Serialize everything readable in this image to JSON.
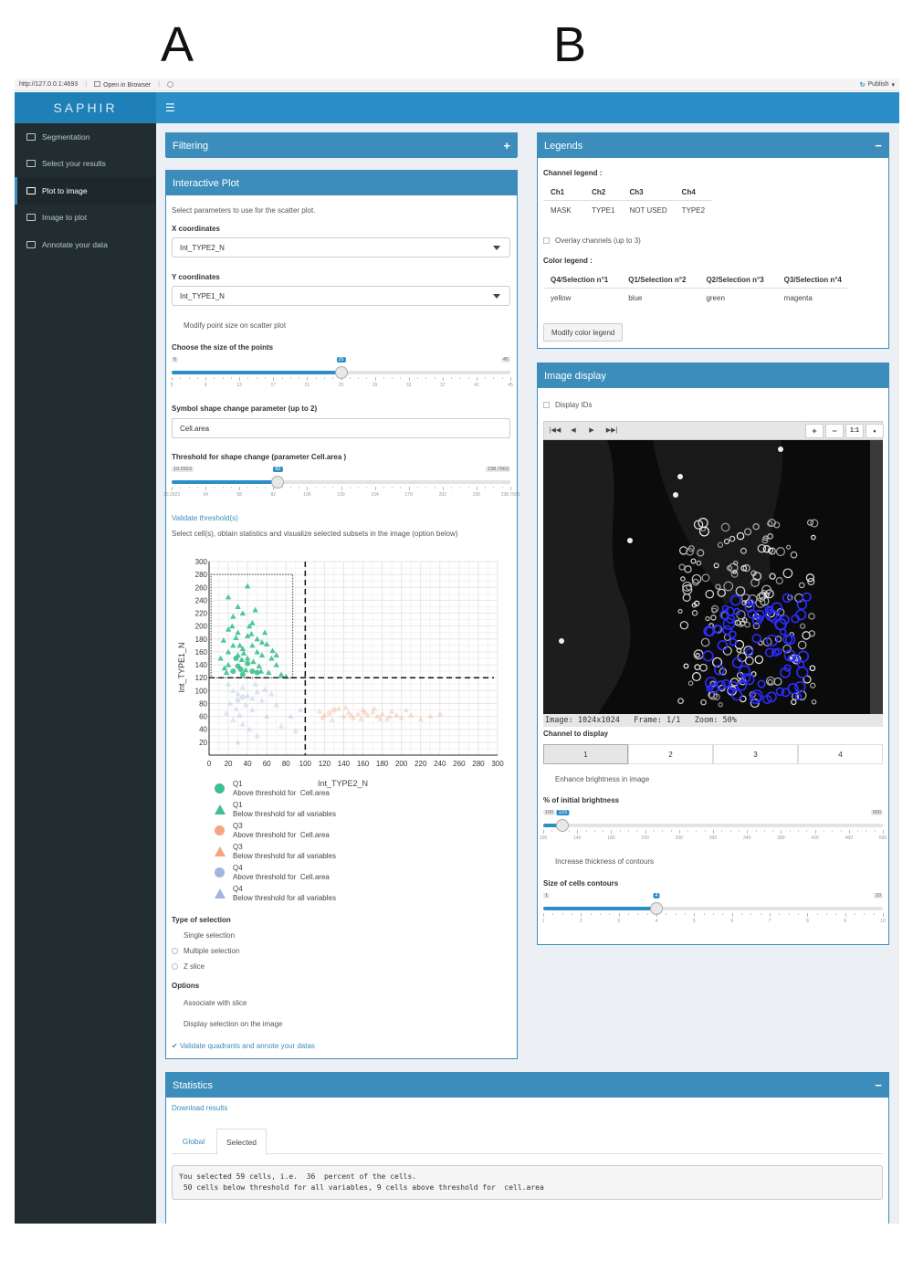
{
  "panel_letters": {
    "a": "A",
    "b": "B"
  },
  "browser": {
    "url": "http://127.0.0.1:4693",
    "open_label": "Open in Browser",
    "publish_label": "Publish"
  },
  "app": {
    "title": "SAPHIR",
    "toggle_icon": "hamburger-icon"
  },
  "sidebar": {
    "items": [
      {
        "label": "Segmentation",
        "icon": "image-icon",
        "active": false
      },
      {
        "label": "Select your results",
        "icon": "upload-icon",
        "active": false
      },
      {
        "label": "Plot to image",
        "icon": "chart-icon",
        "active": true
      },
      {
        "label": "Image to plot",
        "icon": "image-icon",
        "active": false
      },
      {
        "label": "Annotate your data",
        "icon": "edit-icon",
        "active": false
      }
    ]
  },
  "filtering": {
    "title": "Filtering",
    "tool": "+"
  },
  "interactive": {
    "title": "Interactive Plot",
    "intro": "Select parameters to use for the scatter plot.",
    "x_label": "X coordinates",
    "x_value": "Int_TYPE2_N",
    "y_label": "Y coordinates",
    "y_value": "Int_TYPE1_N",
    "modify_point_size": "Modify point size on scatter plot",
    "point_size_label": "Choose the size of the points",
    "point_size": {
      "min": 5,
      "max": 45,
      "value": 25,
      "min_label": "5",
      "max_label": "45",
      "value_label": "25",
      "ticks": [
        "5",
        "9",
        "13",
        "17",
        "21",
        "25",
        "29",
        "33",
        "37",
        "41",
        "45"
      ]
    },
    "symbol_label": "Symbol shape change parameter (up to 2)",
    "symbol_value": "Cell.area",
    "threshold_label": "Threshold for shape change (parameter Cell.area )",
    "threshold": {
      "min": 10.2923,
      "max": 238.7563,
      "value": 82,
      "min_label": "10.2923",
      "max_label": "238.7563",
      "value_label": "82",
      "ticks": [
        "10.2923",
        "34",
        "58",
        "82",
        "106",
        "130",
        "154",
        "178",
        "202",
        "226",
        "238.7563"
      ]
    },
    "validate_threshold": "Validate threshold(s)",
    "select_hint": "Select cell(s), obtain statistics and visualize selected subsets in the image (option below)",
    "selection_type_label": "Type of selection",
    "selection_options": [
      "Single selection",
      "Multiple selection",
      "Z slice"
    ],
    "options_label": "Options",
    "option_items": [
      "Associate with slice",
      "Display selection on the image"
    ],
    "validate_quadrants": "Validate quadrants and annote your datas"
  },
  "chart_data": {
    "type": "scatter",
    "xlabel": "Int_TYPE2_N",
    "ylabel": "Int_TYPE1_N",
    "xlim": [
      0,
      300
    ],
    "ylim": [
      0,
      300
    ],
    "x_ticks": [
      0,
      20,
      40,
      60,
      80,
      100,
      120,
      140,
      160,
      180,
      200,
      220,
      240,
      260,
      280,
      300
    ],
    "y_ticks": [
      20,
      40,
      60,
      80,
      100,
      120,
      140,
      160,
      180,
      200,
      220,
      240,
      260,
      280,
      300
    ],
    "grid": true,
    "threshold_x": 100,
    "threshold_y": 120,
    "selection_box": {
      "x": [
        2,
        87
      ],
      "y": [
        120,
        280
      ]
    },
    "colors": {
      "Q1": "#3cc08e",
      "Q3": "#f4a582",
      "Q4": "#a3b4e0"
    },
    "legend": [
      {
        "quadrant": "Q1",
        "shape": "circle",
        "color": "#3cc08e",
        "desc": "Above threshold for  Cell.area"
      },
      {
        "quadrant": "Q1",
        "shape": "triangle",
        "color": "#3cc08e",
        "desc": "Below threshold for all variables"
      },
      {
        "quadrant": "Q3",
        "shape": "circle",
        "color": "#f4a582",
        "desc": "Above threshold for  Cell.area"
      },
      {
        "quadrant": "Q3",
        "shape": "triangle",
        "color": "#f4a582",
        "desc": "Below threshold for all variables"
      },
      {
        "quadrant": "Q4",
        "shape": "circle",
        "color": "#a3b4e0",
        "desc": "Above threshold for  Cell.area"
      },
      {
        "quadrant": "Q4",
        "shape": "triangle",
        "color": "#a3b4e0",
        "desc": "Below threshold for all variables"
      }
    ],
    "series": [
      {
        "quadrant": "Q1",
        "shape": "circle",
        "points": [
          [
            25,
            130
          ],
          [
            30,
            138
          ],
          [
            35,
            125
          ],
          [
            40,
            142
          ],
          [
            45,
            130
          ],
          [
            50,
            128
          ],
          [
            28,
            150
          ],
          [
            33,
            133
          ]
        ]
      },
      {
        "quadrant": "Q1",
        "shape": "triangle",
        "points": [
          [
            40,
            262
          ],
          [
            20,
            245
          ],
          [
            30,
            230
          ],
          [
            25,
            215
          ],
          [
            35,
            220
          ],
          [
            45,
            205
          ],
          [
            20,
            195
          ],
          [
            30,
            190
          ],
          [
            40,
            185
          ],
          [
            50,
            180
          ],
          [
            55,
            175
          ],
          [
            25,
            170
          ],
          [
            35,
            165
          ],
          [
            45,
            170
          ],
          [
            20,
            160
          ],
          [
            30,
            155
          ],
          [
            40,
            150
          ],
          [
            55,
            155
          ],
          [
            65,
            150
          ],
          [
            70,
            140
          ],
          [
            62,
            128
          ],
          [
            75,
            125
          ],
          [
            20,
            140
          ],
          [
            18,
            128
          ],
          [
            50,
            160
          ],
          [
            42,
            200
          ],
          [
            48,
            225
          ],
          [
            15,
            178
          ],
          [
            60,
            172
          ],
          [
            38,
            132
          ],
          [
            52,
            138
          ],
          [
            80,
            122
          ],
          [
            28,
            182
          ],
          [
            44,
            188
          ],
          [
            36,
            158
          ],
          [
            66,
            162
          ],
          [
            12,
            150
          ],
          [
            58,
            190
          ],
          [
            24,
            200
          ],
          [
            34,
            148
          ],
          [
            46,
            145
          ],
          [
            70,
            155
          ],
          [
            16,
            135
          ],
          [
            54,
            130
          ],
          [
            32,
            170
          ]
        ]
      },
      {
        "quadrant": "Q3",
        "shape": "circle",
        "points": [
          [
            125,
            65
          ],
          [
            130,
            70
          ]
        ]
      },
      {
        "quadrant": "Q3",
        "shape": "triangle",
        "points": [
          [
            115,
            68
          ],
          [
            120,
            62
          ],
          [
            135,
            72
          ],
          [
            140,
            60
          ],
          [
            145,
            66
          ],
          [
            150,
            58
          ],
          [
            155,
            64
          ],
          [
            160,
            70
          ],
          [
            165,
            62
          ],
          [
            170,
            67
          ],
          [
            175,
            60
          ],
          [
            180,
            64
          ],
          [
            185,
            56
          ],
          [
            190,
            68
          ],
          [
            200,
            58
          ],
          [
            210,
            62
          ],
          [
            220,
            56
          ],
          [
            230,
            60
          ],
          [
            240,
            64
          ],
          [
            128,
            55
          ],
          [
            142,
            74
          ],
          [
            158,
            56
          ],
          [
            172,
            72
          ],
          [
            195,
            62
          ],
          [
            205,
            70
          ],
          [
            118,
            58
          ],
          [
            148,
            62
          ],
          [
            162,
            66
          ],
          [
            178,
            56
          ],
          [
            188,
            60
          ]
        ]
      },
      {
        "quadrant": "Q4",
        "shape": "circle",
        "points": [
          [
            30,
            85
          ],
          [
            35,
            90
          ]
        ]
      },
      {
        "quadrant": "Q4",
        "shape": "triangle",
        "points": [
          [
            20,
            110
          ],
          [
            25,
            100
          ],
          [
            30,
            95
          ],
          [
            35,
            105
          ],
          [
            40,
            92
          ],
          [
            45,
            88
          ],
          [
            50,
            98
          ],
          [
            22,
            80
          ],
          [
            28,
            72
          ],
          [
            38,
            78
          ],
          [
            45,
            70
          ],
          [
            55,
            85
          ],
          [
            60,
            60
          ],
          [
            25,
            55
          ],
          [
            35,
            48
          ],
          [
            42,
            40
          ],
          [
            50,
            30
          ],
          [
            30,
            20
          ],
          [
            65,
            95
          ],
          [
            70,
            78
          ],
          [
            75,
            45
          ],
          [
            85,
            60
          ],
          [
            90,
            38
          ],
          [
            95,
            70
          ],
          [
            18,
            65
          ],
          [
            48,
            110
          ],
          [
            58,
            102
          ],
          [
            32,
            62
          ]
        ]
      }
    ]
  },
  "legends": {
    "title": "Legends",
    "tool": "−",
    "channel_legend_label": "Channel legend :",
    "channel_headers": [
      "Ch1",
      "Ch2",
      "Ch3",
      "Ch4"
    ],
    "channel_values": [
      "MASK",
      "TYPE1",
      "NOT USED",
      "TYPE2"
    ],
    "overlay_label": "Overlay channels (up to 3)",
    "color_legend_label": "Color legend :",
    "color_headers": [
      "Q4/Selection n°1",
      "Q1/Selection n°2",
      "Q2/Selection n°3",
      "Q3/Selection n°4"
    ],
    "color_values": [
      "yellow",
      "blue",
      "green",
      "magenta"
    ],
    "modify_button": "Modify color legend"
  },
  "image_display": {
    "title": "Image display",
    "display_ids": "Display IDs",
    "toolbar": {
      "first": "|◀◀",
      "prev": "◀",
      "next": "▶",
      "last": "▶▶|",
      "zoom_in": "+",
      "zoom_out": "−",
      "one_to_one": "1:1",
      "fit": "•"
    },
    "status": "Image: 1024x1024   Frame: 1/1   Zoom: 50%",
    "channel_label": "Channel to display",
    "channels": [
      "1",
      "2",
      "3",
      "4"
    ],
    "active_channel": 0,
    "enhance_label": "Enhance brightness in image",
    "brightness_label": "% of initial brightness",
    "brightness": {
      "min": 100,
      "max": 500,
      "value": 123,
      "min_label": "100",
      "max_label": "500",
      "value_label": "123",
      "ticks": [
        "100",
        "140",
        "180",
        "220",
        "260",
        "300",
        "340",
        "380",
        "420",
        "460",
        "500"
      ]
    },
    "thickness_label": "Increase thickness of contours",
    "contours_label": "Size of cells contours",
    "contours": {
      "min": 1,
      "max": 10,
      "value": 4,
      "min_label": "1",
      "max_label": "10",
      "value_label": "4",
      "ticks": [
        "1",
        "2",
        "3",
        "4",
        "5",
        "6",
        "7",
        "8",
        "9",
        "10"
      ]
    }
  },
  "statistics": {
    "title": "Statistics",
    "tool": "−",
    "download": "Download results",
    "tabs": [
      "Global",
      "Selected"
    ],
    "active_tab": 1,
    "output_line1": "You selected 59 cells, i.e.  36  percent of the cells.",
    "output_line2": " 50 cells below threshold for all variables, 9 cells above threshold for  cell.area"
  }
}
